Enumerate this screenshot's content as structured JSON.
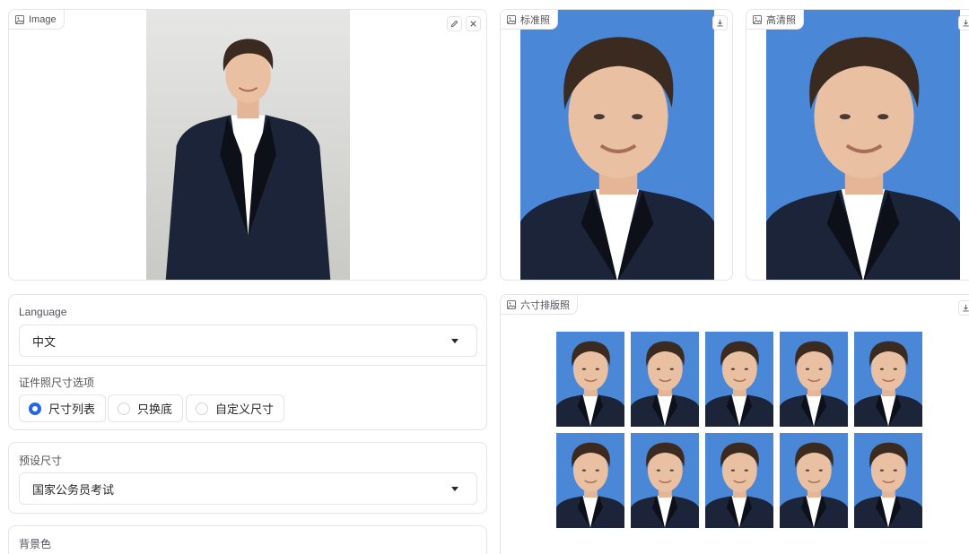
{
  "input_image": {
    "label": "Image"
  },
  "standard_photo": {
    "label": "标准照"
  },
  "hd_photo": {
    "label": "高清照"
  },
  "layout_photo": {
    "label": "六寸排版照"
  },
  "language": {
    "label": "Language",
    "value": "中文"
  },
  "size_options": {
    "label": "证件照尺寸选项",
    "options": [
      {
        "label": "尺寸列表",
        "checked": true
      },
      {
        "label": "只换底",
        "checked": false
      },
      {
        "label": "自定义尺寸",
        "checked": false
      }
    ]
  },
  "preset_size": {
    "label": "预设尺寸",
    "value": "国家公务员考试"
  },
  "background_color": {
    "label": "背景色"
  },
  "colors": {
    "id_photo_blue": "#4a87d6",
    "accent": "#2563eb",
    "suit": "#1b2438",
    "border": "#e4e4e7"
  },
  "icons": [
    "image-icon",
    "edit-icon",
    "close-icon",
    "download-icon",
    "chevron-down-icon"
  ]
}
